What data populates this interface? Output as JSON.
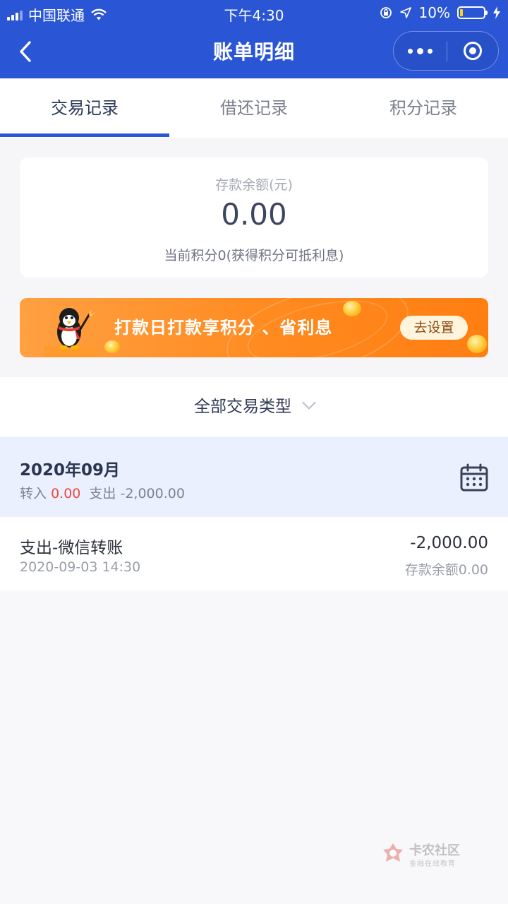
{
  "status_bar": {
    "carrier": "中国联通",
    "time": "下午4:30",
    "battery_percent": "10%"
  },
  "nav": {
    "title": "账单明细"
  },
  "tabs": [
    {
      "label": "交易记录",
      "active": true
    },
    {
      "label": "借还记录",
      "active": false
    },
    {
      "label": "积分记录",
      "active": false
    }
  ],
  "balance": {
    "label": "存款余额(元)",
    "amount": "0.00",
    "points_text": "当前积分0(获得积分可抵利息)"
  },
  "banner": {
    "text": "打款日打款享积分 、省利息",
    "button_label": "去设置"
  },
  "filter": {
    "label": "全部交易类型"
  },
  "month": {
    "title": "2020年09月",
    "in_label": "转入",
    "in_value": "0.00",
    "out_label": "支出",
    "out_value": "-2,000.00"
  },
  "transactions": [
    {
      "title": "支出-微信转账",
      "time": "2020-09-03 14:30",
      "amount": "-2,000.00",
      "balance_after": "存款余额0.00"
    }
  ],
  "watermark": {
    "name": "卡农社区",
    "sub": "金融在线教育"
  },
  "colors": {
    "header_blue": "#2a56d6",
    "accent_red": "#ee4a3f",
    "banner_orange": "#ff8a1f"
  }
}
